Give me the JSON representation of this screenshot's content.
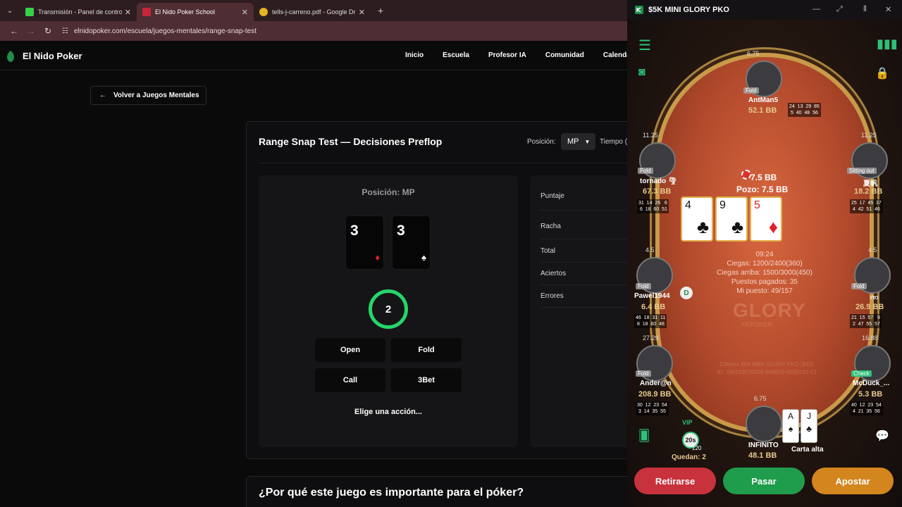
{
  "browser": {
    "tabs": [
      {
        "label": "Transmisión - Panel de control",
        "color": "#35d14b",
        "active": false
      },
      {
        "label": "El Nido Poker School",
        "color": "#c4263a",
        "active": true
      },
      {
        "label": "tells-j-carreno.pdf - Google Dri",
        "color": "#e6b325",
        "active": false
      }
    ],
    "url": "elnidopoker.com/escuela/juegos-mentales/range-snap-test"
  },
  "site": {
    "brand": "El Nido Poker",
    "nav": [
      "Inicio",
      "Escuela",
      "Profesor IA",
      "Comunidad",
      "Calendario"
    ],
    "back_label": "Volver a Juegos Mentales",
    "card": {
      "title": "Range Snap Test — Decisiones Preflop",
      "position_label": "Posición:",
      "position_value": "MP",
      "time_label": "Tiempo (",
      "game": {
        "position_heading": "Posición: MP",
        "cards": [
          {
            "rank": "3",
            "suit": "♦",
            "suit_color": "#e0202a"
          },
          {
            "rank": "3",
            "suit": "♠",
            "suit_color": "#ffffff"
          }
        ],
        "timer": "2",
        "actions": [
          "Open",
          "Fold",
          "Call",
          "3Bet"
        ],
        "prompt": "Elige una acción..."
      },
      "stats": [
        "Puntaje",
        "Racha",
        "Total",
        "Aciertos",
        "Errores"
      ]
    },
    "section2_title": "¿Por qué este juego es importante para el póker?"
  },
  "poker": {
    "title": "$5K MINI GLORY PKO",
    "pot_bet": "7.5 BB",
    "pot": "Pozo: 7.5 BB",
    "board": [
      {
        "rank": "4",
        "suit": "♣",
        "red": false
      },
      {
        "rank": "9",
        "suit": "♣",
        "red": false
      },
      {
        "rank": "5",
        "suit": "♦",
        "red": true
      }
    ],
    "info": {
      "time": "09:24",
      "blinds": "Ciegas: 1200/2400(360)",
      "next_blinds": "Ciegas arriba: 1500/3000(450)",
      "paid": "Puestos pagados: 35",
      "my_place": "Mi puesto: 49/157"
    },
    "watermark": "GLORY",
    "watermark_sub": "KKPOKER",
    "ticket_line1": "13Mess $5K MINI GLORY PKO ($10)",
    "ticket_line2": "ID: 260103070026-649956-0000120-13",
    "seats": [
      {
        "name": "AntMan5",
        "stack": "52.1 BB",
        "bounty": "6.75",
        "tag": "Fold",
        "stats": "24  13  29  85\n 5  40  48  56"
      },
      {
        "name": "tornado 🌪",
        "stack": "67.3 BB",
        "bounty": "11.25",
        "tag": "Fold",
        "stats": "31  14  26   6\n 6  18  60  51"
      },
      {
        "name": "夏帆",
        "stack": "18.2 BB",
        "bounty": "11.25",
        "tag": "Sitting out",
        "stats": "25  17  45  37\n 4  42  51  46"
      },
      {
        "name": "Pawel1944",
        "stack": "6.4 BB",
        "bounty": "4.5",
        "tag": "Fold",
        "stats": "46  18  31  11\n 8  18  60  48"
      },
      {
        "name": "ၮ",
        "stack": "26.9 BB",
        "bounty": "4.5",
        "tag": "Fold",
        "stats": "21  15  57   9\n 2  47  55  57"
      },
      {
        "name": "Ander@n",
        "stack": "208.9 BB",
        "bounty": "27.29",
        "tag": "Fold",
        "stats": "30  12  23  54\n 3  14  35  55"
      },
      {
        "name": "McDuck_...",
        "stack": "5.3 BB",
        "bounty": "16.88",
        "tag": "Check",
        "stats": "40  12  23  54\n 4  21  35  56"
      },
      {
        "name": "INFINITO",
        "stack": "48.1 BB",
        "bounty": "6.75",
        "tag": "",
        "stats": ""
      }
    ],
    "hero_cards": [
      "A",
      "J"
    ],
    "hand_label": "Carta alta",
    "vip": "VIP",
    "timebank": "20s",
    "timebank_count": "120",
    "quedan": "Quedan: 2",
    "buttons": {
      "fold": "Retirarse",
      "check": "Pasar",
      "bet": "Apostar"
    }
  }
}
